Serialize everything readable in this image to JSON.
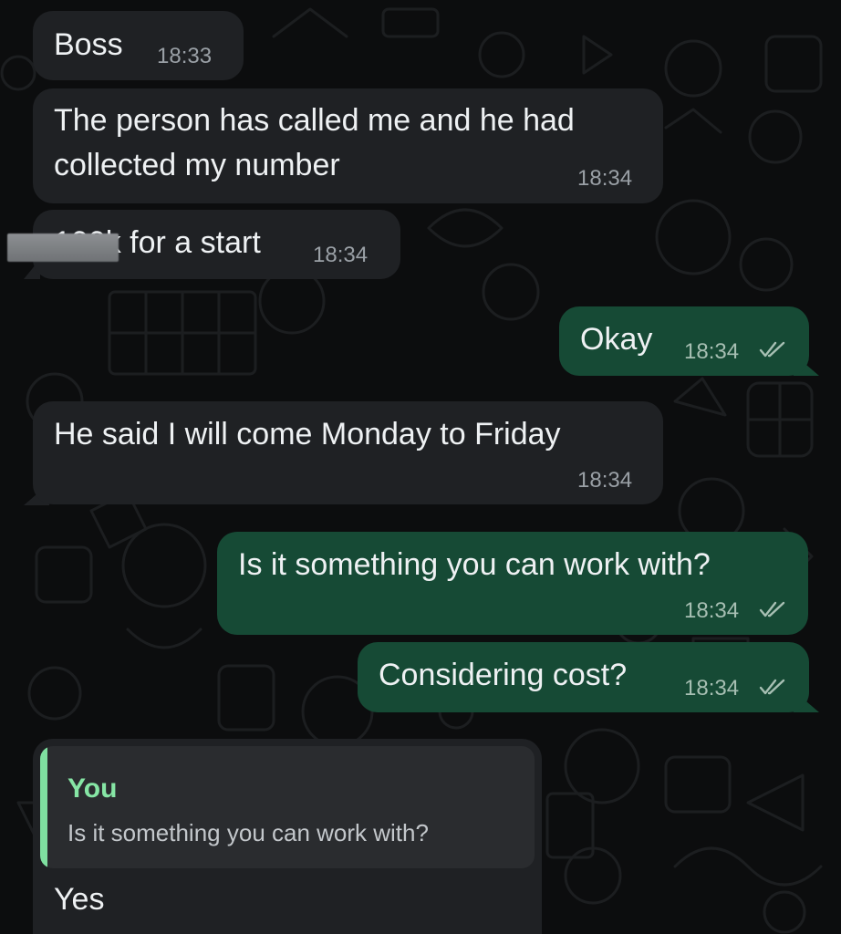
{
  "messages": [
    {
      "direction": "incoming",
      "lines": [
        "Boss"
      ],
      "time": "18:33"
    },
    {
      "direction": "incoming",
      "lines": [
        "The person has called me and he had",
        "collected my number"
      ],
      "time": "18:34"
    },
    {
      "direction": "incoming",
      "lines": [
        "100k for a start"
      ],
      "time": "18:34",
      "redacted": true
    },
    {
      "direction": "outgoing",
      "lines": [
        "Okay"
      ],
      "time": "18:34",
      "status": "read"
    },
    {
      "direction": "incoming",
      "lines": [
        "He said I will come Monday to Friday"
      ],
      "time": "18:34"
    },
    {
      "direction": "outgoing",
      "lines": [
        "Is it something you can work with?"
      ],
      "time": "18:34",
      "status": "read"
    },
    {
      "direction": "outgoing",
      "lines": [
        "Considering cost?"
      ],
      "time": "18:34",
      "status": "read"
    },
    {
      "direction": "incoming",
      "reply_to": {
        "author": "You",
        "text": "Is it something you can work with?"
      },
      "lines": [
        "Yes"
      ]
    }
  ],
  "colors": {
    "background": "#0c0d0e",
    "incoming_bubble": "#1f2124",
    "outgoing_bubble": "#164a35",
    "quote_accent": "#7fe0a0",
    "read_ticks": "#a7bfb3"
  },
  "icons": {
    "read_receipt": "double-check-icon"
  }
}
